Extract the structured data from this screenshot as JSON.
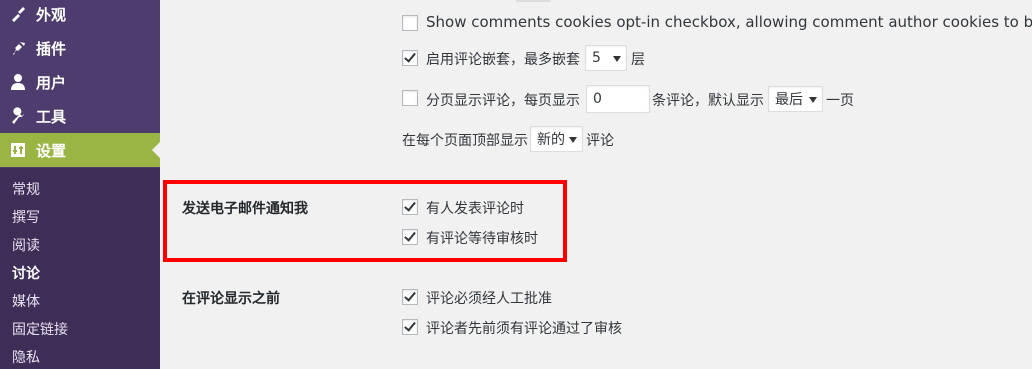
{
  "sidebar": {
    "menu": [
      {
        "label": "外观",
        "icon": "paintbrush-icon"
      },
      {
        "label": "插件",
        "icon": "plugin-icon"
      },
      {
        "label": "用户",
        "icon": "user-icon"
      },
      {
        "label": "工具",
        "icon": "wrench-icon"
      },
      {
        "label": "设置",
        "icon": "settings-icon",
        "active": true
      }
    ],
    "submenu": [
      "常规",
      "撰写",
      "阅读",
      "讨论",
      "媒体",
      "固定链接",
      "隐私"
    ],
    "current_submenu": "讨论"
  },
  "other_settings": {
    "cookies_optin_label": "Show comments cookies opt-in checkbox, allowing comment author cookies to be set.",
    "cookies_optin_checked": false,
    "nested_label_before": "启用评论嵌套，最多嵌套",
    "nested_depth": "5",
    "nested_label_after": "层",
    "nested_checked": true,
    "paged_label_before": "分页显示评论，每页显示",
    "paged_per_page": "0",
    "paged_label_middle": "条评论，默认显示",
    "paged_default_page": "最后",
    "paged_label_after": "一页",
    "paged_checked": false,
    "order_label_before": "在每个页面顶部显示",
    "order_value": "新的",
    "order_label_after": "评论"
  },
  "email_me": {
    "heading": "发送电子邮件通知我",
    "options": [
      {
        "label": "有人发表评论时",
        "checked": true
      },
      {
        "label": "有评论等待审核时",
        "checked": true
      }
    ]
  },
  "before_comment": {
    "heading": "在评论显示之前",
    "options": [
      {
        "label": "评论必须经人工批准",
        "checked": true
      },
      {
        "label": "评论者先前须有评论通过了审核",
        "checked": true
      }
    ]
  },
  "colors": {
    "sidebar_bg": "#4e3c6e",
    "submenu_bg": "#3d2e58",
    "active_bg": "#9bb545",
    "highlight": "#ff0000"
  }
}
